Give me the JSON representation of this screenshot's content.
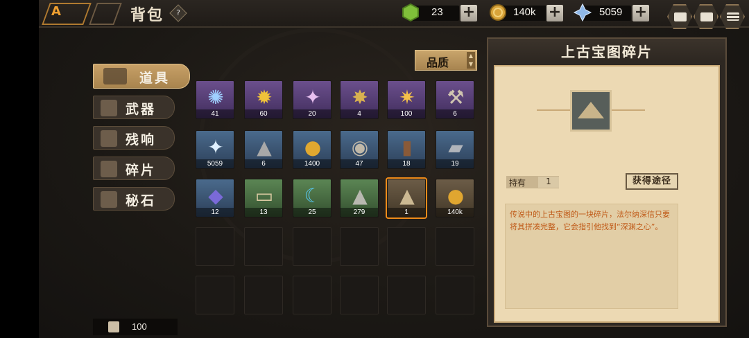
{
  "header": {
    "title": "背包",
    "help_glyph": "?",
    "logo_text": "A"
  },
  "resources": [
    {
      "name": "green-gem",
      "value": "23",
      "color": "#7fbf3a"
    },
    {
      "name": "gold-coin",
      "value": "140k",
      "color": "#d9a43a"
    },
    {
      "name": "crystal",
      "value": "5059",
      "color": "#8fb8e8"
    }
  ],
  "resource_plus": "+",
  "notification": "!",
  "tabs": [
    {
      "label": "道具",
      "active": true
    },
    {
      "label": "武器",
      "active": false
    },
    {
      "label": "残响",
      "active": false
    },
    {
      "label": "碎片",
      "active": false
    },
    {
      "label": "秘石",
      "active": false
    }
  ],
  "capacity": "100",
  "sort": {
    "label": "品质",
    "arrow_up": "▲",
    "arrow_down": "▼"
  },
  "items": [
    {
      "count": "41",
      "rarity": "purple",
      "glyph": "✺",
      "color": "#9fd0ff"
    },
    {
      "count": "60",
      "rarity": "purple",
      "glyph": "✹",
      "color": "#f0c23a"
    },
    {
      "count": "20",
      "rarity": "purple",
      "glyph": "✦",
      "color": "#e8c0f0"
    },
    {
      "count": "4",
      "rarity": "purple",
      "glyph": "✸",
      "color": "#d8b050"
    },
    {
      "count": "100",
      "rarity": "purple",
      "glyph": "✷",
      "color": "#f5c14a"
    },
    {
      "count": "6",
      "rarity": "purple",
      "glyph": "⚒",
      "color": "#d0c4b0"
    },
    {
      "count": "5059",
      "rarity": "blue",
      "glyph": "✦",
      "color": "#dff0ff"
    },
    {
      "count": "6",
      "rarity": "blue",
      "glyph": "▲",
      "color": "#a8a8a8"
    },
    {
      "count": "1400",
      "rarity": "blue",
      "glyph": "●",
      "color": "#e0a830"
    },
    {
      "count": "47",
      "rarity": "blue",
      "glyph": "◉",
      "color": "#c0b8a8"
    },
    {
      "count": "18",
      "rarity": "blue",
      "glyph": "▮",
      "color": "#8a5a38"
    },
    {
      "count": "19",
      "rarity": "blue",
      "glyph": "▰",
      "color": "#b0b4ba"
    },
    {
      "count": "12",
      "rarity": "blue",
      "glyph": "◆",
      "color": "#7a6ad8"
    },
    {
      "count": "13",
      "rarity": "green",
      "glyph": "▭",
      "color": "#d8c8a0"
    },
    {
      "count": "25",
      "rarity": "green",
      "glyph": "☾",
      "color": "#58c8f0"
    },
    {
      "count": "279",
      "rarity": "green",
      "glyph": "▲",
      "color": "#b8b8b0"
    },
    {
      "count": "1",
      "rarity": "brown",
      "glyph": "▲",
      "color": "#cbb892",
      "selected": true
    },
    {
      "count": "140k",
      "rarity": "brown",
      "glyph": "●",
      "color": "#e0a630"
    }
  ],
  "detail": {
    "title": "上古宝图碎片",
    "own_label": "持有",
    "own_value": "1",
    "source_button": "获得途径",
    "description": "传说中的上古宝图的一块碎片，法尔纳深信只要将其拼凑完整，它会指引他找到“深渊之心”。"
  }
}
